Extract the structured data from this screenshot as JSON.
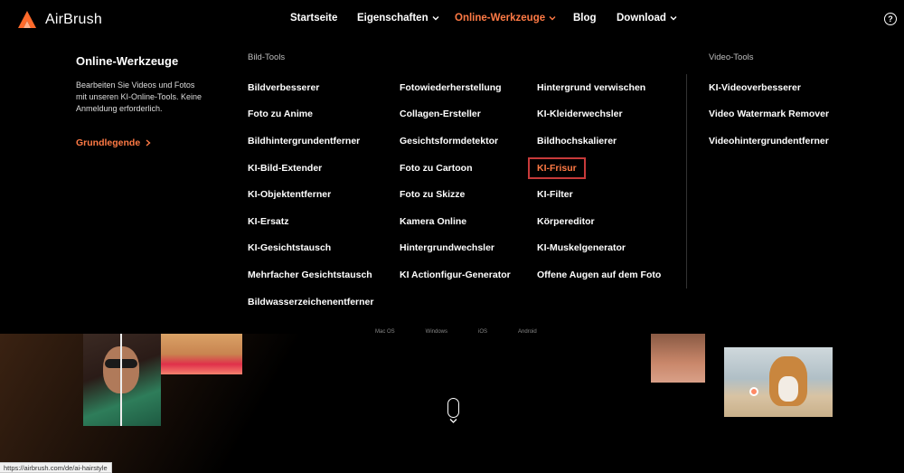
{
  "brand": {
    "name": "AirBrush",
    "accent_color": "#ff7a45"
  },
  "nav": {
    "items": [
      {
        "label": "Startseite",
        "has_dropdown": false,
        "active": false
      },
      {
        "label": "Eigenschaften",
        "has_dropdown": true,
        "active": false
      },
      {
        "label": "Online-Werkzeuge",
        "has_dropdown": true,
        "active": true
      },
      {
        "label": "Blog",
        "has_dropdown": false,
        "active": false
      },
      {
        "label": "Download",
        "has_dropdown": true,
        "active": false
      }
    ],
    "help_icon": "?"
  },
  "menu": {
    "intro": {
      "title": "Online-Werkzeuge",
      "description": "Bearbeiten Sie Videos und Fotos mit unseren KI-Online-Tools. Keine Anmeldung erforderlich.",
      "link": "Grundlegende"
    },
    "image_tools_label": "Bild-Tools",
    "video_tools_label": "Video-Tools",
    "col1": [
      "Bildverbesserer",
      "Foto zu Anime",
      "Bildhintergrundentferner",
      "KI-Bild-Extender",
      "KI-Objektentferner",
      "KI-Ersatz",
      "KI-Gesichtstausch",
      "Mehrfacher Gesichtstausch",
      "Bildwasserzeichenentferner"
    ],
    "col2": [
      "Fotowiederherstellung",
      "Collagen-Ersteller",
      "Gesichtsformdetektor",
      "Foto zu Cartoon",
      "Foto zu Skizze",
      "Kamera Online",
      "Hintergrundwechsler",
      "KI Actionfigur-Generator"
    ],
    "col3": [
      "Hintergrund verwischen",
      "KI-Kleiderwechsler",
      "Bildhochskalierer",
      "KI-Frisur",
      "KI-Filter",
      "Körpereditor",
      "KI-Muskelgenerator",
      "Offene Augen auf dem Foto"
    ],
    "col4": [
      "KI-Videoverbesserer",
      "Video Watermark Remover",
      "Videohintergrundentferner"
    ],
    "highlighted_item": "KI-Frisur"
  },
  "background": {
    "platforms": [
      "Mac OS",
      "Windows",
      "iOS",
      "Android"
    ]
  },
  "status_url": "https://airbrush.com/de/ai-hairstyle"
}
